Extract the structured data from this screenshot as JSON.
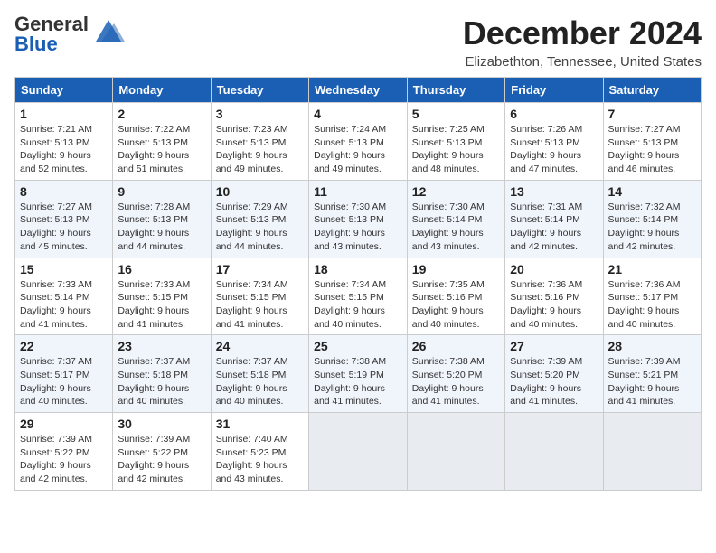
{
  "logo": {
    "general": "General",
    "blue": "Blue"
  },
  "title": "December 2024",
  "location": "Elizabethton, Tennessee, United States",
  "days_of_week": [
    "Sunday",
    "Monday",
    "Tuesday",
    "Wednesday",
    "Thursday",
    "Friday",
    "Saturday"
  ],
  "weeks": [
    [
      {
        "day": "1",
        "sunrise": "7:21 AM",
        "sunset": "5:13 PM",
        "daylight": "9 hours and 52 minutes."
      },
      {
        "day": "2",
        "sunrise": "7:22 AM",
        "sunset": "5:13 PM",
        "daylight": "9 hours and 51 minutes."
      },
      {
        "day": "3",
        "sunrise": "7:23 AM",
        "sunset": "5:13 PM",
        "daylight": "9 hours and 49 minutes."
      },
      {
        "day": "4",
        "sunrise": "7:24 AM",
        "sunset": "5:13 PM",
        "daylight": "9 hours and 49 minutes."
      },
      {
        "day": "5",
        "sunrise": "7:25 AM",
        "sunset": "5:13 PM",
        "daylight": "9 hours and 48 minutes."
      },
      {
        "day": "6",
        "sunrise": "7:26 AM",
        "sunset": "5:13 PM",
        "daylight": "9 hours and 47 minutes."
      },
      {
        "day": "7",
        "sunrise": "7:27 AM",
        "sunset": "5:13 PM",
        "daylight": "9 hours and 46 minutes."
      }
    ],
    [
      {
        "day": "8",
        "sunrise": "7:27 AM",
        "sunset": "5:13 PM",
        "daylight": "9 hours and 45 minutes."
      },
      {
        "day": "9",
        "sunrise": "7:28 AM",
        "sunset": "5:13 PM",
        "daylight": "9 hours and 44 minutes."
      },
      {
        "day": "10",
        "sunrise": "7:29 AM",
        "sunset": "5:13 PM",
        "daylight": "9 hours and 44 minutes."
      },
      {
        "day": "11",
        "sunrise": "7:30 AM",
        "sunset": "5:13 PM",
        "daylight": "9 hours and 43 minutes."
      },
      {
        "day": "12",
        "sunrise": "7:30 AM",
        "sunset": "5:14 PM",
        "daylight": "9 hours and 43 minutes."
      },
      {
        "day": "13",
        "sunrise": "7:31 AM",
        "sunset": "5:14 PM",
        "daylight": "9 hours and 42 minutes."
      },
      {
        "day": "14",
        "sunrise": "7:32 AM",
        "sunset": "5:14 PM",
        "daylight": "9 hours and 42 minutes."
      }
    ],
    [
      {
        "day": "15",
        "sunrise": "7:33 AM",
        "sunset": "5:14 PM",
        "daylight": "9 hours and 41 minutes."
      },
      {
        "day": "16",
        "sunrise": "7:33 AM",
        "sunset": "5:15 PM",
        "daylight": "9 hours and 41 minutes."
      },
      {
        "day": "17",
        "sunrise": "7:34 AM",
        "sunset": "5:15 PM",
        "daylight": "9 hours and 41 minutes."
      },
      {
        "day": "18",
        "sunrise": "7:34 AM",
        "sunset": "5:15 PM",
        "daylight": "9 hours and 40 minutes."
      },
      {
        "day": "19",
        "sunrise": "7:35 AM",
        "sunset": "5:16 PM",
        "daylight": "9 hours and 40 minutes."
      },
      {
        "day": "20",
        "sunrise": "7:36 AM",
        "sunset": "5:16 PM",
        "daylight": "9 hours and 40 minutes."
      },
      {
        "day": "21",
        "sunrise": "7:36 AM",
        "sunset": "5:17 PM",
        "daylight": "9 hours and 40 minutes."
      }
    ],
    [
      {
        "day": "22",
        "sunrise": "7:37 AM",
        "sunset": "5:17 PM",
        "daylight": "9 hours and 40 minutes."
      },
      {
        "day": "23",
        "sunrise": "7:37 AM",
        "sunset": "5:18 PM",
        "daylight": "9 hours and 40 minutes."
      },
      {
        "day": "24",
        "sunrise": "7:37 AM",
        "sunset": "5:18 PM",
        "daylight": "9 hours and 40 minutes."
      },
      {
        "day": "25",
        "sunrise": "7:38 AM",
        "sunset": "5:19 PM",
        "daylight": "9 hours and 41 minutes."
      },
      {
        "day": "26",
        "sunrise": "7:38 AM",
        "sunset": "5:20 PM",
        "daylight": "9 hours and 41 minutes."
      },
      {
        "day": "27",
        "sunrise": "7:39 AM",
        "sunset": "5:20 PM",
        "daylight": "9 hours and 41 minutes."
      },
      {
        "day": "28",
        "sunrise": "7:39 AM",
        "sunset": "5:21 PM",
        "daylight": "9 hours and 41 minutes."
      }
    ],
    [
      {
        "day": "29",
        "sunrise": "7:39 AM",
        "sunset": "5:22 PM",
        "daylight": "9 hours and 42 minutes."
      },
      {
        "day": "30",
        "sunrise": "7:39 AM",
        "sunset": "5:22 PM",
        "daylight": "9 hours and 42 minutes."
      },
      {
        "day": "31",
        "sunrise": "7:40 AM",
        "sunset": "5:23 PM",
        "daylight": "9 hours and 43 minutes."
      },
      null,
      null,
      null,
      null
    ]
  ]
}
